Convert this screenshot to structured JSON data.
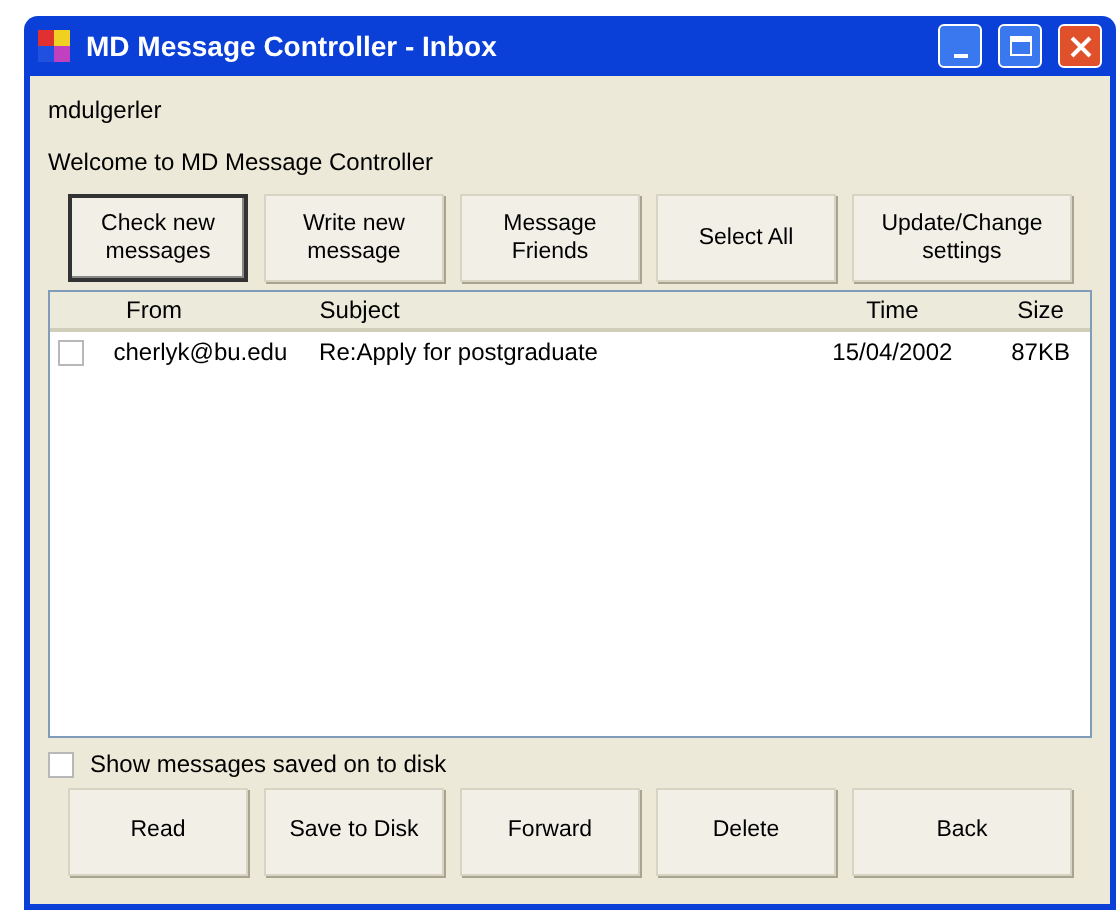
{
  "window": {
    "title": "MD Message Controller - Inbox"
  },
  "username": "mdulgerler",
  "welcome": "Welcome to MD Message Controller",
  "top_buttons": [
    {
      "label": "Check new\nmessages",
      "focused": true
    },
    {
      "label": "Write new\nmessage",
      "focused": false
    },
    {
      "label": "Message\nFriends",
      "focused": false
    },
    {
      "label": "Select All",
      "focused": false
    },
    {
      "label": "Update/Change\nsettings",
      "focused": false
    }
  ],
  "table": {
    "columns": [
      "From",
      "Subject",
      "Time",
      "Size"
    ],
    "rows": [
      {
        "checked": false,
        "cells": [
          "cherlyk@bu.edu",
          "Re:Apply for postgraduate",
          "15/04/2002",
          "87KB"
        ]
      }
    ]
  },
  "show_saved": {
    "label": "Show messages saved on to disk",
    "checked": false
  },
  "bottom_buttons": [
    "Read",
    "Save to Disk",
    "Forward",
    "Delete",
    "Back"
  ]
}
